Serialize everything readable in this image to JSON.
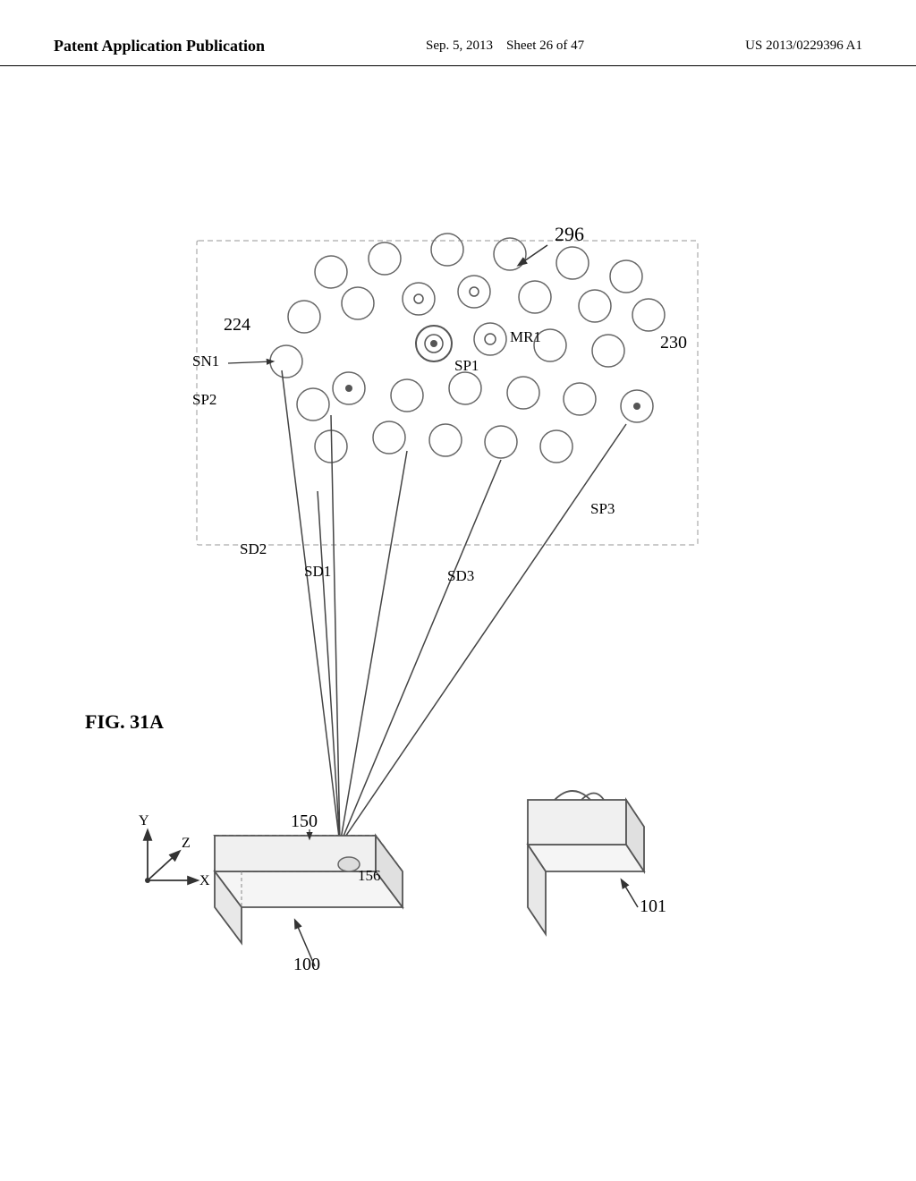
{
  "header": {
    "left_label": "Patent Application Publication",
    "center_date": "Sep. 5, 2013",
    "center_sheet": "Sheet 26 of 47",
    "right_patent": "US 2013/0229396 A1"
  },
  "diagram": {
    "fig_label": "FIG. 31A",
    "labels": {
      "label_296": "296",
      "label_224": "224",
      "label_230": "230",
      "label_sn1": "SN1",
      "label_sp2": "SP2",
      "label_sp1": "SP1",
      "label_mr1": "MR1",
      "label_sd2": "SD2",
      "label_sd1": "SD1",
      "label_sd3": "SD3",
      "label_sp3": "SP3",
      "label_150": "150",
      "label_156": "156",
      "label_100": "100",
      "label_101": "101",
      "label_y": "Y",
      "label_z": "Z",
      "label_x": "X"
    }
  }
}
